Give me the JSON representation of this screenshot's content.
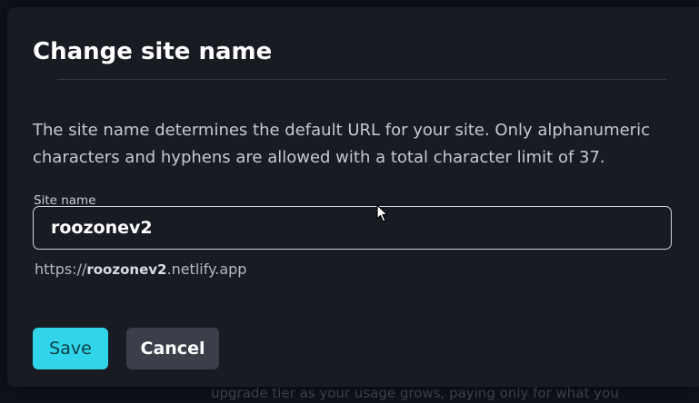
{
  "dialog": {
    "title": "Change site name",
    "description": "The site name determines the default URL for your site. Only alphanumeric characters and hyphens are allowed with a total character limit of 37.",
    "field_label": "Site name",
    "site_name_value": "roozonev2",
    "url_prefix": "https://",
    "url_name": "roozonev2",
    "url_suffix": ".netlify.app",
    "save_label": "Save",
    "cancel_label": "Cancel"
  },
  "background": {
    "bottom_text": "upgrade tier as your usage grows, paying only for what you"
  },
  "colors": {
    "save_button": "#30d5ea",
    "cancel_button": "#3a3f4a",
    "modal_background": "#181b22"
  }
}
